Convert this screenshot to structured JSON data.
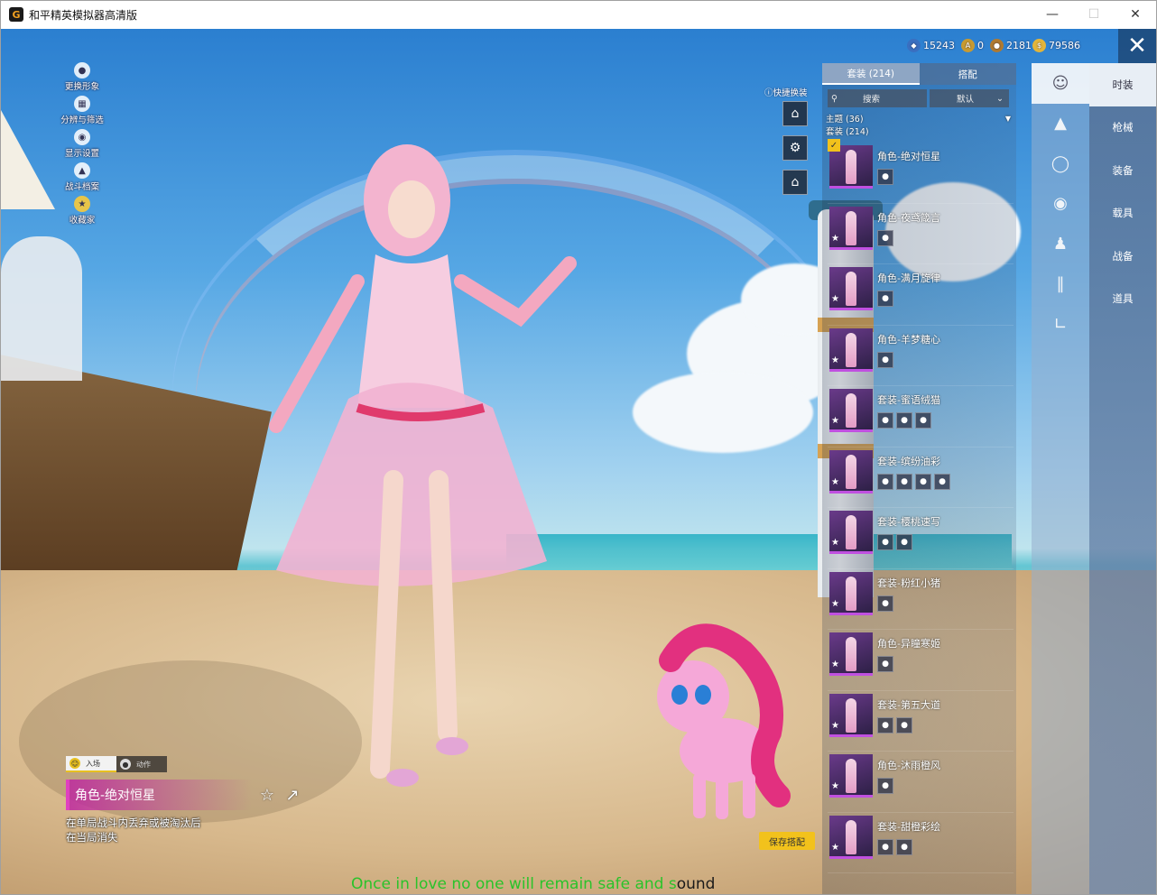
{
  "window": {
    "title": "和平精英模拟器高清版",
    "app_icon": "G"
  },
  "left_tools": [
    {
      "label": "更换形象",
      "icon": "avatar-icon"
    },
    {
      "label": "分辨与筛选",
      "icon": "grid-icon"
    },
    {
      "label": "显示设置",
      "icon": "eye-icon"
    },
    {
      "label": "战斗档案",
      "icon": "profile-icon"
    },
    {
      "label": "收藏家",
      "icon": "collector-icon"
    }
  ],
  "quick_change": {
    "label": "快捷换装"
  },
  "currencies": [
    {
      "value": "15243",
      "color": "#3a6fc0"
    },
    {
      "value": "0",
      "color": "#c89a30"
    },
    {
      "value": "2181",
      "color": "#b07a30"
    },
    {
      "value": "79586",
      "color": "#e3b53a"
    }
  ],
  "panel": {
    "tabs": [
      "套装 (214)",
      "搭配"
    ],
    "search_label": "搜索",
    "sort_label": "默认",
    "themes_label": "主题 (36)",
    "suits_label": "套装 (214)"
  },
  "outfits": [
    {
      "name": "角色-绝对恒星",
      "selected": true,
      "parts": 1
    },
    {
      "name": "角色-夜鸢箴言",
      "selected": false,
      "parts": 1
    },
    {
      "name": "角色-满月旋律",
      "selected": false,
      "parts": 1
    },
    {
      "name": "角色-羊梦糖心",
      "selected": false,
      "parts": 1
    },
    {
      "name": "套装-蜜语绒猫",
      "selected": false,
      "parts": 3
    },
    {
      "name": "套装-缤纷油彩",
      "selected": false,
      "parts": 4
    },
    {
      "name": "套装-樱桃速写",
      "selected": false,
      "parts": 2
    },
    {
      "name": "套装-粉红小猪",
      "selected": false,
      "parts": 1
    },
    {
      "name": "角色-异瞳寒姬",
      "selected": false,
      "parts": 1
    },
    {
      "name": "套装-第五大道",
      "selected": false,
      "parts": 2
    },
    {
      "name": "角色-沐雨橙风",
      "selected": false,
      "parts": 1
    },
    {
      "name": "套装-甜橙彩绘",
      "selected": false,
      "parts": 2
    }
  ],
  "categories": [
    {
      "label": "时装",
      "icon": "outfit-icon",
      "active": true
    },
    {
      "label": "枪械",
      "icon": "cap-icon",
      "active": false
    },
    {
      "label": "装备",
      "icon": "goggles-icon",
      "active": false
    },
    {
      "label": "载具",
      "icon": "mask-icon",
      "active": false
    },
    {
      "label": "战备",
      "icon": "top-icon",
      "active": false
    },
    {
      "label": "道具",
      "icon": "pants-icon",
      "active": false
    }
  ],
  "extra_category_icon": "shoes-icon",
  "motion_tabs": [
    "入场",
    "动作"
  ],
  "selected_item": {
    "name": "角色-绝对恒星",
    "description": "在单局战斗内丢弃或被淘汰后在当局消失"
  },
  "save_button": "保存搭配",
  "subtitle": {
    "main": "Once in love no one will remain safe and s",
    "tail": "ound"
  },
  "accent_color": "#f2c21c"
}
